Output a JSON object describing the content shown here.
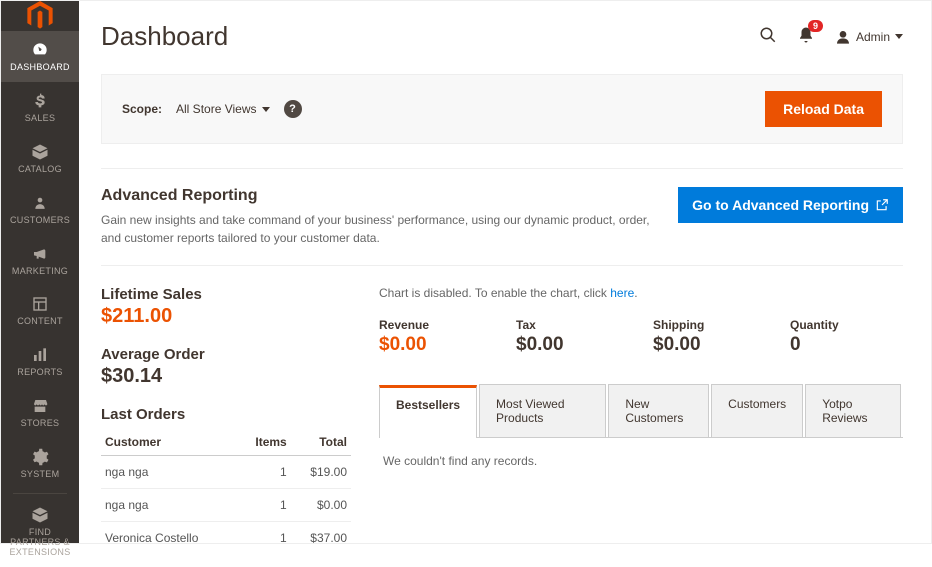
{
  "page_title": "Dashboard",
  "header": {
    "notif_count": "9",
    "admin_label": "Admin"
  },
  "sidebar": {
    "items": [
      {
        "label": "DASHBOARD"
      },
      {
        "label": "SALES"
      },
      {
        "label": "CATALOG"
      },
      {
        "label": "CUSTOMERS"
      },
      {
        "label": "MARKETING"
      },
      {
        "label": "CONTENT"
      },
      {
        "label": "REPORTS"
      },
      {
        "label": "STORES"
      },
      {
        "label": "SYSTEM"
      },
      {
        "label": "FIND PARTNERS & EXTENSIONS"
      }
    ]
  },
  "scope": {
    "label": "Scope:",
    "value": "All Store Views",
    "reload_label": "Reload Data"
  },
  "advanced": {
    "title": "Advanced Reporting",
    "desc": "Gain new insights and take command of your business' performance, using our dynamic product, order, and customer reports tailored to your customer data.",
    "button": "Go to Advanced Reporting"
  },
  "stats": {
    "lifetime_title": "Lifetime Sales",
    "lifetime_value": "$211.00",
    "avg_title": "Average Order",
    "avg_value": "$30.14"
  },
  "last_orders": {
    "title": "Last Orders",
    "col_customer": "Customer",
    "col_items": "Items",
    "col_total": "Total",
    "rows": [
      {
        "customer": "nga nga",
        "items": "1",
        "total": "$19.00"
      },
      {
        "customer": "nga nga",
        "items": "1",
        "total": "$0.00"
      },
      {
        "customer": "Veronica Costello",
        "items": "1",
        "total": "$37.00"
      }
    ]
  },
  "chart": {
    "note_prefix": "Chart is disabled. To enable the chart, click ",
    "note_link": "here",
    "note_suffix": "."
  },
  "metrics": {
    "revenue_label": "Revenue",
    "revenue_value": "$0.00",
    "tax_label": "Tax",
    "tax_value": "$0.00",
    "shipping_label": "Shipping",
    "shipping_value": "$0.00",
    "quantity_label": "Quantity",
    "quantity_value": "0"
  },
  "tabs": {
    "bestsellers": "Bestsellers",
    "most_viewed": "Most Viewed Products",
    "new_customers": "New Customers",
    "customers": "Customers",
    "yotpo": "Yotpo Reviews",
    "empty_msg": "We couldn't find any records."
  }
}
